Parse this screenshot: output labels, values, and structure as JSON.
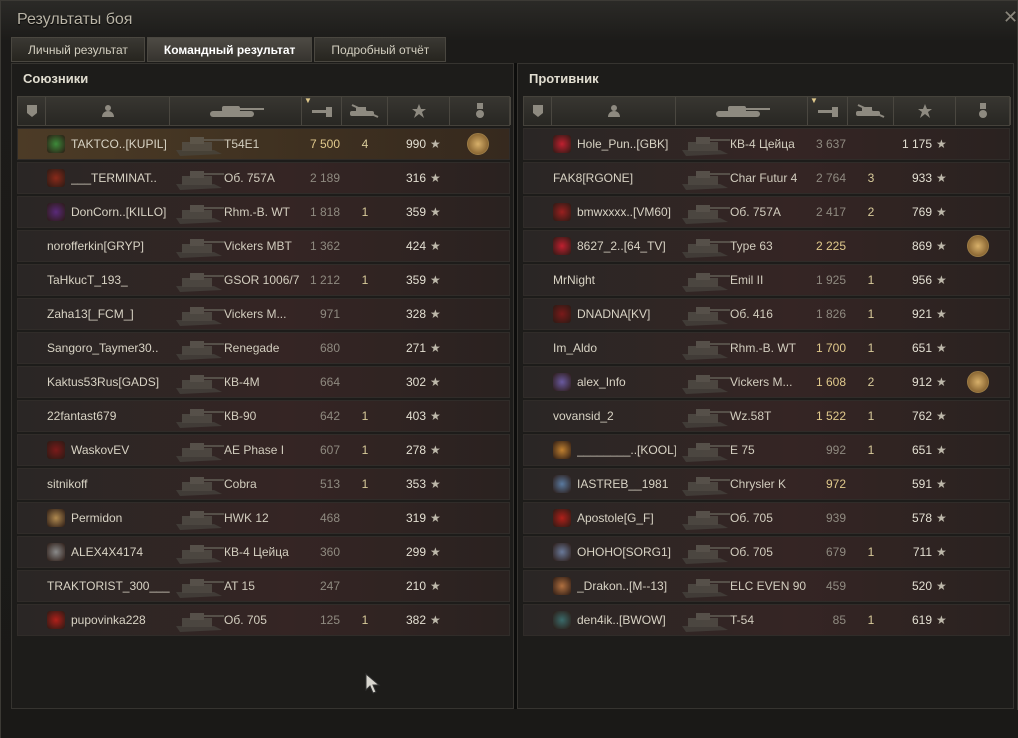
{
  "window": {
    "title": "Результаты боя",
    "close_icon": "close-icon"
  },
  "tabs": [
    {
      "label": "Личный результат",
      "active": false
    },
    {
      "label": "Командный результат",
      "active": true
    },
    {
      "label": "Подробный отчёт",
      "active": false
    }
  ],
  "allies": {
    "title": "Союзники",
    "rows": [
      {
        "name": "TAKTCO..[KUPIL]",
        "vehicle": "T54E1",
        "damage": "7 500",
        "kills": "4",
        "xp": "990",
        "medal": true,
        "me": true,
        "badge_color": "#3d8a3a",
        "dmg_hi": true
      },
      {
        "name": "___TERMINAT..",
        "vehicle": "Об. 757А",
        "damage": "2 189",
        "kills": "",
        "xp": "316",
        "medal": false,
        "badge_color": "#8a2a1a"
      },
      {
        "name": "DonCorn..[KILLO]",
        "vehicle": "Rhm.-B. WT",
        "damage": "1 818",
        "kills": "1",
        "xp": "359",
        "medal": false,
        "badge_color": "#5a2a7a"
      },
      {
        "name": "norofferkin[GRYP]",
        "vehicle": "Vickers MBT",
        "damage": "1 362",
        "kills": "",
        "xp": "424",
        "medal": false,
        "badge_color": ""
      },
      {
        "name": "TaHkucT_193_",
        "vehicle": "GSOR 1006/7",
        "damage": "1 212",
        "kills": "1",
        "xp": "359",
        "medal": false,
        "badge_color": ""
      },
      {
        "name": "Zaha13[_FCM_]",
        "vehicle": "Vickers M...",
        "damage": "971",
        "kills": "",
        "xp": "328",
        "medal": false,
        "badge_color": ""
      },
      {
        "name": "Sangoro_Taymer30..",
        "vehicle": "Renegade",
        "damage": "680",
        "kills": "",
        "xp": "271",
        "medal": false,
        "badge_color": ""
      },
      {
        "name": "Kaktus53Rus[GADS]",
        "vehicle": "КВ-4М",
        "damage": "664",
        "kills": "",
        "xp": "302",
        "medal": false,
        "badge_color": ""
      },
      {
        "name": "22fantast679",
        "vehicle": "КВ-90",
        "damage": "642",
        "kills": "1",
        "xp": "403",
        "medal": false,
        "badge_color": ""
      },
      {
        "name": "WaskovEV",
        "vehicle": "AE Phase I",
        "damage": "607",
        "kills": "1",
        "xp": "278",
        "medal": false,
        "badge_color": "#7a1a1a"
      },
      {
        "name": "sitnikoff",
        "vehicle": "Cobra",
        "damage": "513",
        "kills": "1",
        "xp": "353",
        "medal": false,
        "badge_color": ""
      },
      {
        "name": "Permidon",
        "vehicle": "HWK 12",
        "damage": "468",
        "kills": "",
        "xp": "319",
        "medal": false,
        "badge_color": "#b08a50"
      },
      {
        "name": "ALEX4X4174",
        "vehicle": "КВ-4 Цейца",
        "damage": "360",
        "kills": "",
        "xp": "299",
        "medal": false,
        "badge_color": "#8a8a8a"
      },
      {
        "name": "TRAKTORIST_300___",
        "vehicle": "AT 15",
        "damage": "247",
        "kills": "",
        "xp": "210",
        "medal": false,
        "badge_color": ""
      },
      {
        "name": "pupovinka228",
        "vehicle": "Об. 705",
        "damage": "125",
        "kills": "1",
        "xp": "382",
        "medal": false,
        "badge_color": "#b0201a"
      }
    ]
  },
  "enemies": {
    "title": "Противник",
    "rows": [
      {
        "name": "Hole_Pun..[GBK]",
        "vehicle": "КВ-4 Цейца",
        "damage": "3 637",
        "kills": "",
        "xp": "1 175",
        "medal": false,
        "badge_color": "#c02030"
      },
      {
        "name": "FAK8[RGONE]",
        "vehicle": "Char Futur 4",
        "damage": "2 764",
        "kills": "3",
        "xp": "933",
        "medal": false,
        "badge_color": ""
      },
      {
        "name": "bmwxxxx..[VM60]",
        "vehicle": "Об. 757А",
        "damage": "2 417",
        "kills": "2",
        "xp": "769",
        "medal": false,
        "badge_color": "#9a2020"
      },
      {
        "name": "8627_2..[64_TV]",
        "vehicle": "Type 63",
        "damage": "2 225",
        "kills": "",
        "xp": "869",
        "medal": true,
        "badge_color": "#c02030",
        "dmg_hi": true
      },
      {
        "name": "MrNight",
        "vehicle": "Emil II",
        "damage": "1 925",
        "kills": "1",
        "xp": "956",
        "medal": false,
        "badge_color": ""
      },
      {
        "name": "DNADNA[KV]",
        "vehicle": "Об. 416",
        "damage": "1 826",
        "kills": "1",
        "xp": "921",
        "medal": false,
        "badge_color": "#7a1a1a"
      },
      {
        "name": "Im_Aldo",
        "vehicle": "Rhm.-B. WT",
        "damage": "1 700",
        "kills": "1",
        "xp": "651",
        "medal": false,
        "badge_color": "",
        "dmg_hi": true
      },
      {
        "name": "alex_Info",
        "vehicle": "Vickers M...",
        "damage": "1 608",
        "kills": "2",
        "xp": "912",
        "medal": true,
        "badge_color": "#6a5aa0",
        "dmg_hi": true
      },
      {
        "name": "vovansid_2",
        "vehicle": "Wz.58T",
        "damage": "1 522",
        "kills": "1",
        "xp": "762",
        "medal": false,
        "badge_color": "",
        "dmg_hi": true
      },
      {
        "name": "________..[KOOL]",
        "vehicle": "E 75",
        "damage": "992",
        "kills": "1",
        "xp": "651",
        "medal": false,
        "badge_color": "#c08030"
      },
      {
        "name": "IASTREB__1981",
        "vehicle": "Chrysler K",
        "damage": "972",
        "kills": "",
        "xp": "591",
        "medal": false,
        "badge_color": "#5a7aa0",
        "dmg_hi": true
      },
      {
        "name": "Apostole[G_F]",
        "vehicle": "Об. 705",
        "damage": "939",
        "kills": "",
        "xp": "578",
        "medal": false,
        "badge_color": "#b0201a"
      },
      {
        "name": "OHOHO[SORG1]",
        "vehicle": "Об. 705",
        "damage": "679",
        "kills": "1",
        "xp": "711",
        "medal": false,
        "badge_color": "#6a7a9a"
      },
      {
        "name": "_Drakon..[M--13]",
        "vehicle": "ELC EVEN 90",
        "damage": "459",
        "kills": "",
        "xp": "520",
        "medal": false,
        "badge_color": "#b07040"
      },
      {
        "name": "den4ik..[BWOW]",
        "vehicle": "T-54",
        "damage": "85",
        "kills": "1",
        "xp": "619",
        "medal": false,
        "badge_color": "#3a6a6a"
      }
    ]
  },
  "icons": {
    "xp_star": "★",
    "header_icons": [
      "clan-icon",
      "player-icon",
      "tank-icon",
      "damage-icon",
      "kills-icon",
      "xp-star-icon",
      "medal-icon"
    ]
  },
  "colors": {
    "accent_row": "#4c3b26",
    "damage_high": "#e0c98c",
    "damage_low": "#8f8a80"
  }
}
